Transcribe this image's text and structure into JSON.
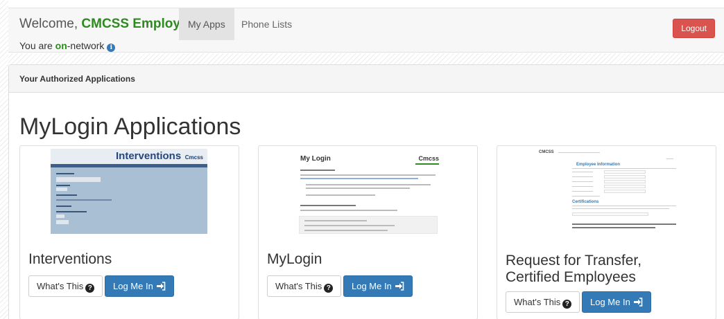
{
  "navbar": {
    "welcome_prefix": "Welcome,",
    "user_name": "CMCSS Employee",
    "network_prefix": "You are",
    "network_status": "on",
    "network_suffix": "-network",
    "tabs": [
      {
        "label": "My Apps",
        "active": true
      },
      {
        "label": "Phone Lists",
        "active": false
      }
    ],
    "logout_label": "Logout"
  },
  "panel": {
    "heading": "Your Authorized Applications",
    "section_title": "MyLogin Applications"
  },
  "apps": [
    {
      "name": "Interventions",
      "whats_this_label": "What's This",
      "login_label": "Log Me In",
      "thumbnail": {
        "title": "Interventions",
        "logo": "Cmcss"
      }
    },
    {
      "name": "MyLogin",
      "whats_this_label": "What's This",
      "login_label": "Log Me In",
      "thumbnail": {
        "title": "My Login",
        "logo": "Cmcss"
      }
    },
    {
      "name_line1": "Request for Transfer,",
      "name_line2": "Certified Employees",
      "whats_this_label": "What's This",
      "login_label": "Log Me In",
      "thumbnail": {
        "header": "CMCSS",
        "section": "Employee Information",
        "section2": "Certifications"
      }
    }
  ],
  "colors": {
    "on_network": "#2d8a1e",
    "logout": "#d9534f",
    "primary": "#337ab7"
  }
}
